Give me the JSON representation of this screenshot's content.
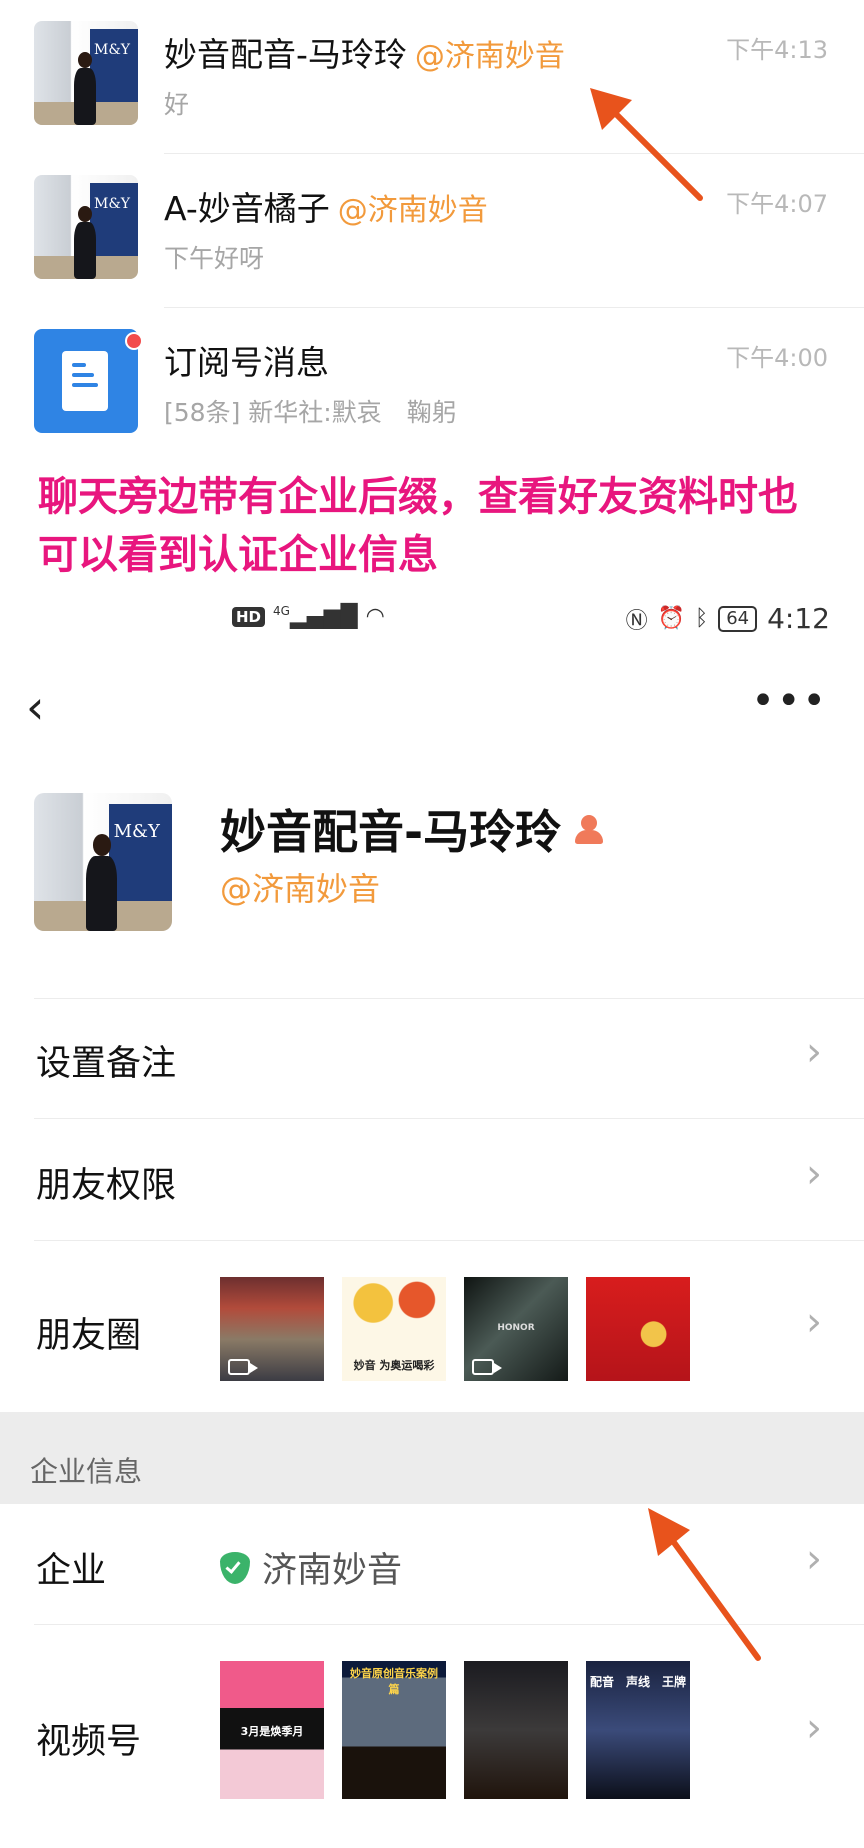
{
  "chat_list": [
    {
      "name": "妙音配音-马玲玲",
      "corp": "@济南妙音",
      "time": "下午4:13",
      "preview": "好"
    },
    {
      "name": "A-妙音橘子",
      "corp": "@济南妙音",
      "time": "下午4:07",
      "preview": "下午好呀"
    },
    {
      "name": "订阅号消息",
      "corp": "",
      "time": "下午4:00",
      "preview": "[58条] 新华社:默哀　鞠躬"
    }
  ],
  "avatar_sign": "M&Y",
  "caption": {
    "line1": "聊天旁边带有企业后缀，查看好友资料时也",
    "line2": "可以看到认证企业信息"
  },
  "status_bar": {
    "network": "4G",
    "hd": "HD",
    "battery": "64",
    "time": "4:12"
  },
  "profile": {
    "back_icon": "chevron-left-icon",
    "more_icon": "more-dots-icon",
    "name": "妙音配音-马玲玲",
    "corp": "@济南妙音"
  },
  "rows": {
    "remark": "设置备注",
    "permission": "朋友权限",
    "moments": "朋友圈",
    "section_title": "企业信息",
    "company_label": "企业",
    "company_value": "济南妙音",
    "channels": "视频号"
  },
  "moments_thumbs": [
    {
      "caption": ""
    },
    {
      "caption": "妙音 为奥运喝彩"
    },
    {
      "caption": "HONOR"
    },
    {
      "caption": ""
    }
  ],
  "channel_thumbs": [
    {
      "caption": "3月是焕季月"
    },
    {
      "caption": "妙音原创音乐案例篇"
    },
    {
      "caption": ""
    },
    {
      "caption": "配音　声线　王牌"
    }
  ],
  "colors": {
    "corp_suffix": "#f29a3c",
    "caption": "#e8167e",
    "arrow": "#e8531c",
    "verified": "#3bb36a"
  }
}
